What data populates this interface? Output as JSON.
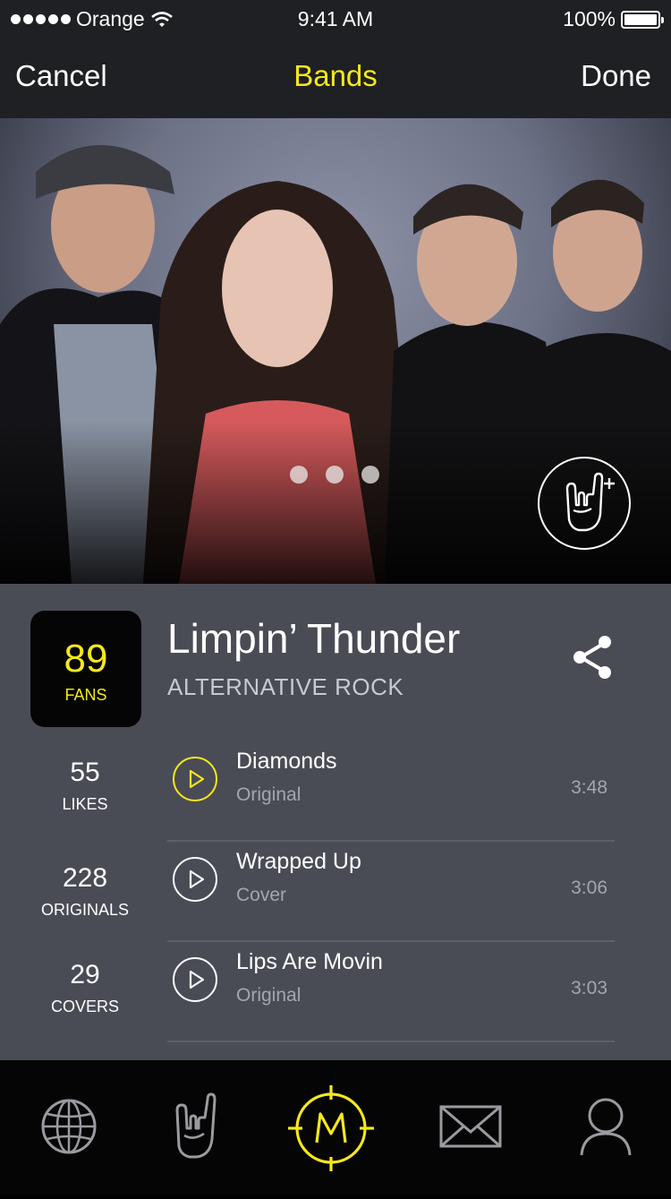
{
  "status_bar": {
    "carrier": "Orange",
    "time": "9:41 AM",
    "battery": "100%",
    "battery_level": 1.0
  },
  "nav": {
    "cancel": "Cancel",
    "title": "Bands",
    "done": "Done"
  },
  "hero": {
    "page_count": 3,
    "icons": {
      "fan_button": "rock-hand-plus-icon"
    }
  },
  "band": {
    "fans_count": "89",
    "fans_label": "FANS",
    "name": "Limpin’ Thunder",
    "genre": "ALTERNATIVE ROCK",
    "share_icon": "share-icon"
  },
  "stats": [
    {
      "value": "55",
      "label": "LIKES"
    },
    {
      "value": "228",
      "label": "ORIGINALS"
    },
    {
      "value": "29",
      "label": "COVERS"
    }
  ],
  "tracks": [
    {
      "title": "Diamonds",
      "kind": "Original",
      "duration": "3:48",
      "active": true
    },
    {
      "title": "Wrapped Up",
      "kind": "Cover",
      "duration": "3:06",
      "active": false
    },
    {
      "title": "Lips Are Movin",
      "kind": "Original",
      "duration": "3:03",
      "active": false
    }
  ],
  "colors": {
    "accent": "#f6e81b",
    "panel": "#4a4c55",
    "bar": "#1f2023",
    "tabbar": "#050505"
  },
  "tabbar": {
    "tabs": [
      {
        "icon": "globe-icon"
      },
      {
        "icon": "rock-hand-icon"
      },
      {
        "icon": "m-target-icon",
        "active": true
      },
      {
        "icon": "envelope-icon"
      },
      {
        "icon": "user-icon"
      }
    ]
  }
}
